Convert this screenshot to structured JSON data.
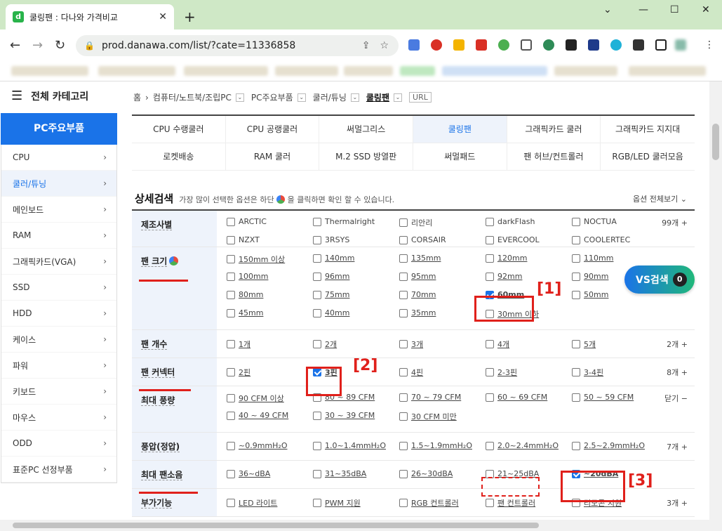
{
  "browser": {
    "tab_title": "쿨링팬 : 다나와 가격비교",
    "favicon_letter": "d",
    "url": "prod.danawa.com/list/?cate=11336858"
  },
  "sidebar": {
    "all_categories": "전체 카테고리",
    "main_category": "PC주요부품",
    "items": [
      {
        "label": "CPU",
        "active": false
      },
      {
        "label": "쿨러/튜닝",
        "active": true
      },
      {
        "label": "메인보드",
        "active": false
      },
      {
        "label": "RAM",
        "active": false
      },
      {
        "label": "그래픽카드(VGA)",
        "active": false
      },
      {
        "label": "SSD",
        "active": false
      },
      {
        "label": "HDD",
        "active": false
      },
      {
        "label": "케이스",
        "active": false
      },
      {
        "label": "파워",
        "active": false
      },
      {
        "label": "키보드",
        "active": false
      },
      {
        "label": "마우스",
        "active": false
      },
      {
        "label": "ODD",
        "active": false
      },
      {
        "label": "표준PC 선정부품",
        "active": false
      }
    ]
  },
  "breadcrumb": {
    "home": "홈",
    "l1": "컴퓨터/노트북/조립PC",
    "l2": "PC주요부품",
    "l3": "쿨러/튜닝",
    "current": "쿨링팬",
    "url_btn": "URL"
  },
  "subcategories": [
    [
      "CPU 수랭쿨러",
      "CPU 공랭쿨러",
      "써멀그리스",
      "쿨링팬",
      "그래픽카드 쿨러",
      "그래픽카드 지지대"
    ],
    [
      "로켓배송",
      "RAM 쿨러",
      "M.2 SSD 방열판",
      "써멀패드",
      "팬 허브/컨트롤러",
      "RGB/LED 쿨러모음"
    ]
  ],
  "detail": {
    "title": "상세검색",
    "desc_before": "가장 많이 선택한 옵션은 하단",
    "desc_after": "을 클릭하면 확인 할 수 있습니다.",
    "view_all": "옵션 전체보기 ⌄"
  },
  "filters": {
    "maker": {
      "label": "제조사별",
      "more": "99개 +",
      "options": [
        "ARCTIC",
        "Thermalright",
        "리안리",
        "darkFlash",
        "NOCTUA",
        "NZXT",
        "3RSYS",
        "CORSAIR",
        "EVERCOOL",
        "COOLERTEC"
      ]
    },
    "fan_size": {
      "label": "팬 크기",
      "options": [
        "150mm 이상",
        "140mm",
        "135mm",
        "120mm",
        "110mm",
        "100mm",
        "96mm",
        "95mm",
        "92mm",
        "90mm",
        "80mm",
        "75mm",
        "70mm",
        "60mm",
        "50mm",
        "45mm",
        "40mm",
        "35mm",
        "30mm 이하"
      ],
      "checked": "60mm"
    },
    "fan_count": {
      "label": "팬 개수",
      "more": "2개 +",
      "options": [
        "1개",
        "2개",
        "3개",
        "4개",
        "5개"
      ]
    },
    "connector": {
      "label": "팬 커넥터",
      "more": "8개 +",
      "options": [
        "2핀",
        "3핀",
        "4핀",
        "2-3핀",
        "3-4핀"
      ],
      "checked": "3핀"
    },
    "airflow": {
      "label": "최대 풍량",
      "more": "닫기 −",
      "options": [
        "90 CFM 이상",
        "80 ~ 89 CFM",
        "70 ~ 79 CFM",
        "60 ~ 69 CFM",
        "50 ~ 59 CFM",
        "40 ~ 49 CFM",
        "30 ~ 39 CFM",
        "30 CFM 미만"
      ]
    },
    "pressure": {
      "label": "풍압(정압)",
      "more": "7개 +",
      "options": [
        "~0.9mmH₂O",
        "1.0~1.4mmH₂O",
        "1.5~1.9mmH₂O",
        "2.0~2.4mmH₂O",
        "2.5~2.9mmH₂O"
      ]
    },
    "noise": {
      "label": "최대 팬소음",
      "options": [
        "36~dBA",
        "31~35dBA",
        "26~30dBA",
        "21~25dBA",
        "~20dBA"
      ],
      "checked": "~20dBA"
    },
    "extra": {
      "label": "부가기능",
      "more": "3개 +",
      "options": [
        "LED 라이트",
        "PWM 지원",
        "RGB 컨트롤러",
        "팬 컨트롤러",
        "리모콘 지원"
      ]
    }
  },
  "annotations": [
    "[1]",
    "[2]",
    "[3]"
  ],
  "vs_button": {
    "label": "VS검색",
    "count": "0"
  }
}
